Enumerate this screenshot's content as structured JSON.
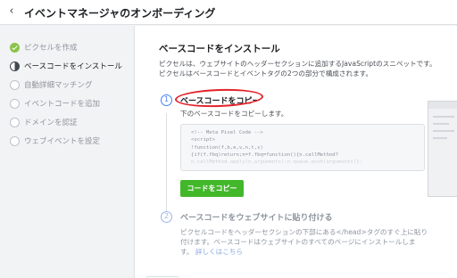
{
  "header": {
    "title": "イベントマネージャのオンボーディング"
  },
  "sidebar": {
    "steps": [
      {
        "label": "ピクセルを作成",
        "state": "done"
      },
      {
        "label": "ベースコードをインストール",
        "state": "current"
      },
      {
        "label": "自動詳細マッチング",
        "state": "todo"
      },
      {
        "label": "イベントコードを追加",
        "state": "todo"
      },
      {
        "label": "ドメインを認証",
        "state": "todo"
      },
      {
        "label": "ウェブイベントを設定",
        "state": "todo"
      }
    ]
  },
  "main": {
    "heading": "ベースコードをインストール",
    "description_lines": [
      "ピクセルは、ウェブサイトのヘッダーセクションに追加するJavaScriptのスニペットです。",
      "ピクセルはベースコードとイベントタグの2つの部分で構成されます。"
    ],
    "step1": {
      "number": "1",
      "title": "ベースコードをコピー",
      "subtitle": "下のベースコードをコピーします。",
      "code_lines": [
        "<!-- Meta Pixel Code -->",
        "<script>",
        "!function(f,b,e,v,n,t,s)",
        "{if(f.fbq)return;n=f.fbq=function(){n.callMethod?",
        "n.callMethod.apply(n,arguments):n.queue.push(arguments)};"
      ],
      "copy_button": "コードをコピー"
    },
    "step2": {
      "number": "2",
      "title": "ベースコードをウェブサイトに貼り付ける",
      "description_lines": [
        "ピクセルコードをヘッダーセクションの下部にある</head>タグのすぐ上に貼り",
        "付けます。ベースコードはウェブサイトのすべてのページにインストールしま"
      ],
      "description_tail": "す。",
      "link": "詳しくはこちら"
    }
  },
  "colors": {
    "accent": "#4080ff",
    "button": "#42b72a",
    "done": "#8bc34a",
    "annotation": "#e2232a"
  }
}
